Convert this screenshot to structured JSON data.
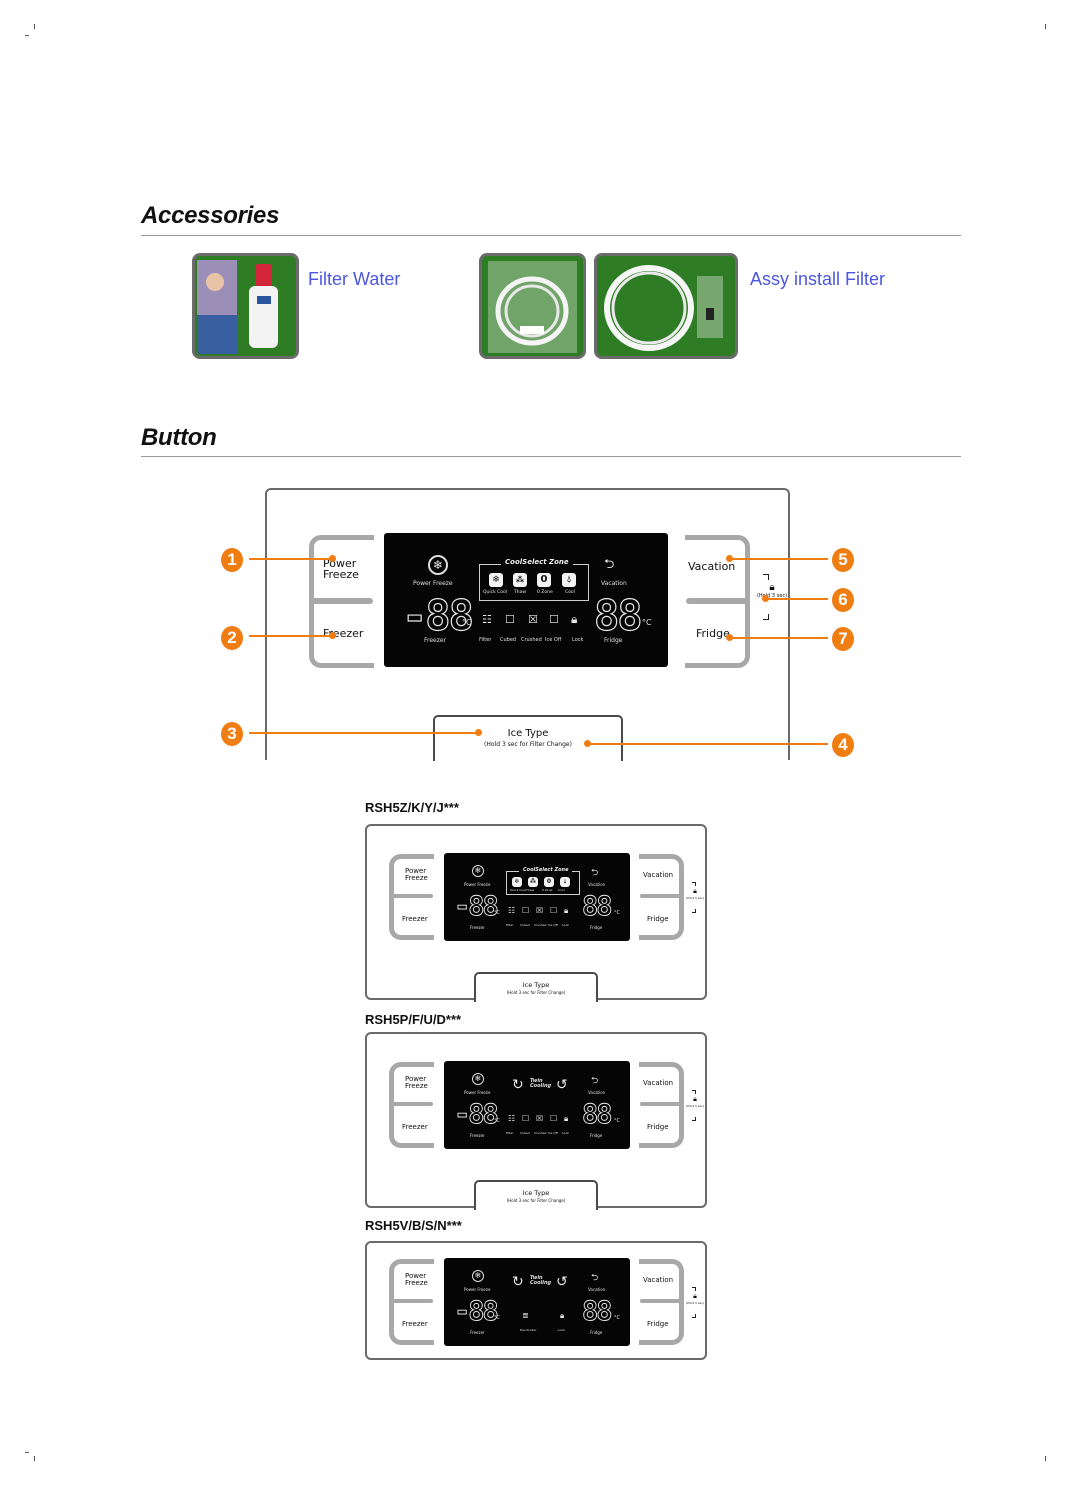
{
  "accessories": {
    "title": "Accessories",
    "items": [
      {
        "label": "Filter Water",
        "photo": "water-filter-cartridge-and-box"
      },
      {
        "label": "Assy install Filter",
        "photo": "water-tube-installation-kit"
      }
    ]
  },
  "button_section": {
    "title": "Button",
    "callouts": [
      "1",
      "2",
      "3",
      "4",
      "5",
      "6",
      "7"
    ],
    "accent_color": "#f07d12",
    "main_panel": {
      "left_buttons": {
        "power_freeze": "Power\nFreeze",
        "freezer": "Freezer"
      },
      "right_buttons": {
        "vacation": "Vacation",
        "fridge": "Fridge"
      },
      "lock_hint": "(Hold 3 sec)",
      "ice_type": {
        "label": "Ice Type",
        "hint": "(Hold 3 sec for Filter Change)"
      },
      "display": {
        "power_freeze_label": "Power Freeze",
        "coolselect_title": "CoolSelect Zone",
        "coolselect_items": [
          "Quick Cool",
          "Thaw",
          "0 Zone",
          "Cool"
        ],
        "vacation_label": "Vacation",
        "freezer_temp": "-88",
        "fridge_temp": "88",
        "unit": "°C",
        "freezer_label": "Freezer",
        "fridge_label": "Fridge",
        "status_icons": [
          "Filter",
          "Cubed",
          "Crushed",
          "Ice Off",
          "Lock"
        ]
      }
    },
    "models": [
      {
        "name": "RSH5Z/K/Y/J***",
        "power_freeze": "Power\nFreeze",
        "freezer": "Freezer",
        "vacation": "Vacation",
        "fridge": "Fridge",
        "lock_hint": "(Hold 3 sec)",
        "center": "CoolSelect Zone",
        "center_items": [
          "Quick Cool",
          "Thaw",
          "0 Zone",
          "Cool"
        ],
        "display_labels": {
          "power_freeze": "Power Freeze",
          "vacation": "Vacation",
          "freezer": "Freezer",
          "fridge": "Fridge"
        },
        "temps": {
          "freezer": "-88",
          "fridge": "88",
          "unit": "°C"
        },
        "status_icons": [
          "Filter",
          "Cubed",
          "Crushed",
          "Ice Off",
          "Lock"
        ],
        "ice_type": {
          "label": "Ice Type",
          "hint": "(Hold 3 sec for Filter Change)"
        }
      },
      {
        "name": "RSH5P/F/U/D***",
        "power_freeze": "Power\nFreeze",
        "freezer": "Freezer",
        "vacation": "Vacation",
        "fridge": "Fridge",
        "lock_hint": "(Hold 3 sec)",
        "center": "Twin\nCooling",
        "display_labels": {
          "power_freeze": "Power Freeze",
          "vacation": "Vacation",
          "freezer": "Freezer",
          "fridge": "Fridge"
        },
        "temps": {
          "freezer": "-88",
          "fridge": "88",
          "unit": "°C"
        },
        "status_icons": [
          "Filter",
          "Cubed",
          "Crushed",
          "Ice Off",
          "Lock"
        ],
        "ice_type": {
          "label": "Ice Type",
          "hint": "(Hold 3 sec for Filter Change)"
        }
      },
      {
        "name": "RSH5V/B/S/N***",
        "power_freeze": "Power\nFreeze",
        "freezer": "Freezer",
        "vacation": "Vacation",
        "fridge": "Fridge",
        "lock_hint": "(Hold 3 sec)",
        "center": "Twin\nCooling",
        "display_labels": {
          "power_freeze": "Power Freeze",
          "vacation": "Vacation",
          "freezer": "Freezer",
          "fridge": "Fridge"
        },
        "temps": {
          "freezer": "-88",
          "fridge": "88",
          "unit": "°C"
        },
        "status_icons": [
          "Deodorizer",
          "Lock"
        ]
      }
    ]
  }
}
